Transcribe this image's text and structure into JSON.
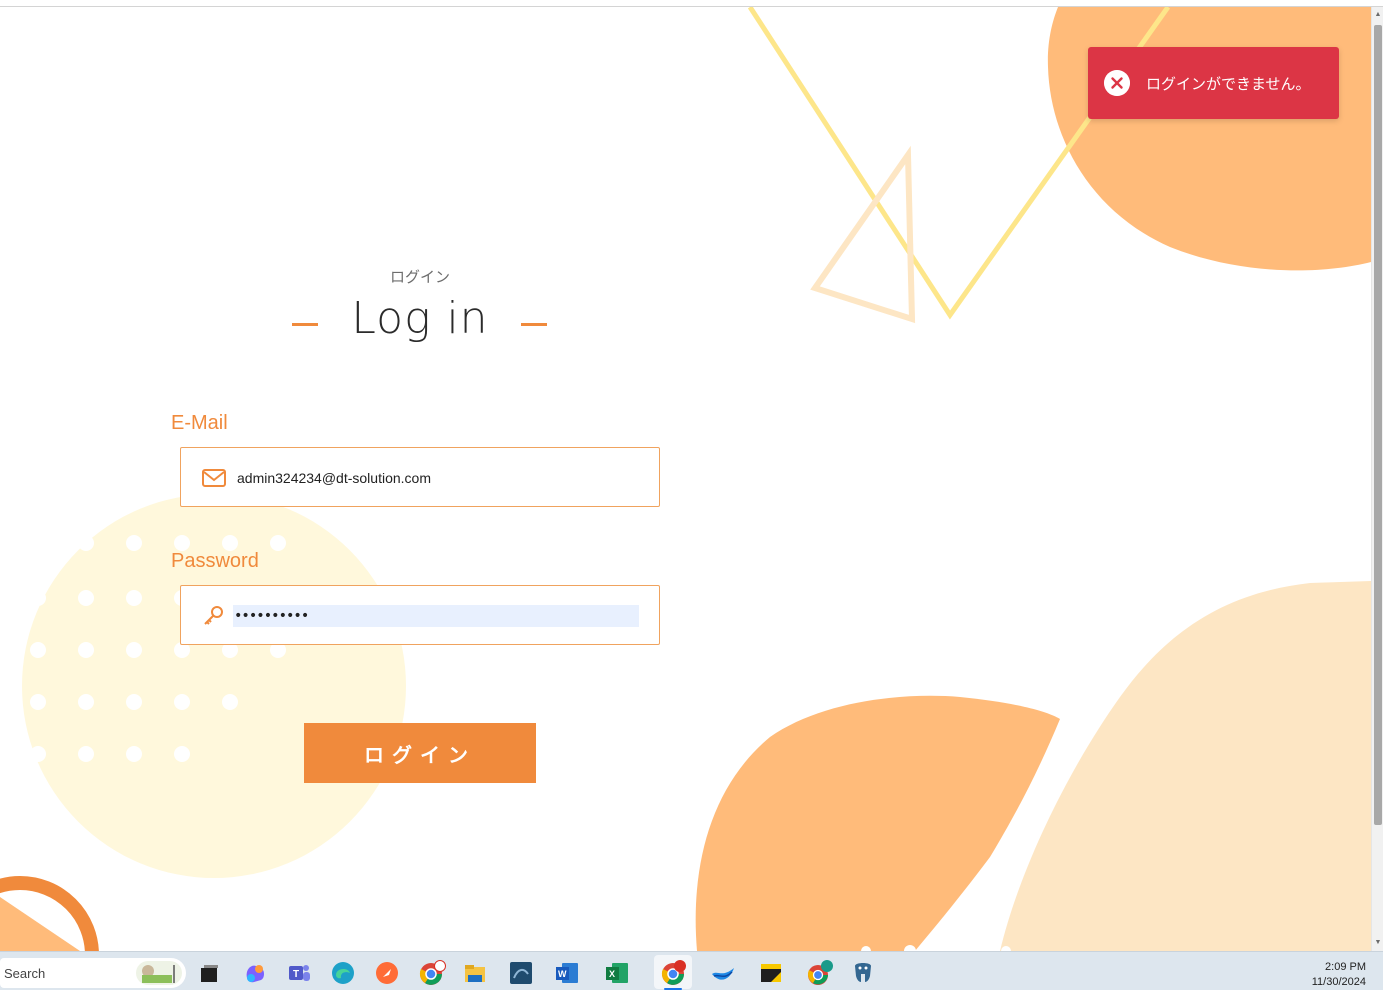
{
  "login": {
    "subtitle": "ログイン",
    "title": "Log in",
    "email_label": "E-Mail",
    "email_value": "admin324234@dt-solution.com",
    "password_label": "Password",
    "password_value": "••••••••••",
    "submit_label": "ログイン"
  },
  "toast": {
    "message": "ログインができません。",
    "type": "error"
  },
  "taskbar": {
    "search_label": "Search",
    "time": "2:09 PM",
    "date": "11/30/2024"
  },
  "colors": {
    "accent": "#f08a3c",
    "error": "#dc3545",
    "blob_orange": "#ffbb7a",
    "blob_peach": "#fde6c4",
    "circle_cream": "#fff8dc",
    "line_yellow": "#fde68a"
  }
}
